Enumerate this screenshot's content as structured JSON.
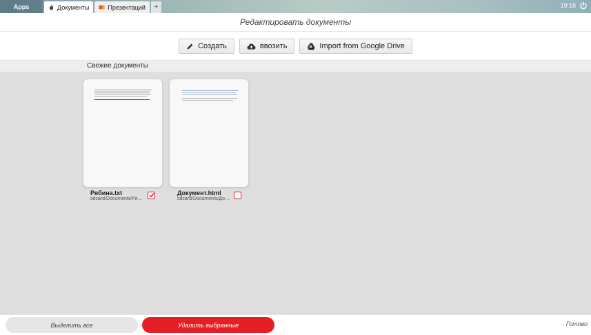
{
  "tabbar": {
    "apps_label": "Apps",
    "tabs": [
      {
        "label": "Документы",
        "icon": "flame-icon",
        "active": true
      },
      {
        "label": "Презентаций",
        "icon": "slides-icon",
        "active": false
      }
    ],
    "add_label": "+",
    "clock": "19:18",
    "power_icon": "power-icon"
  },
  "page": {
    "title": "Редактировать документы"
  },
  "toolbar": {
    "create_label": "Создать",
    "import_label": "ввозить",
    "gdrive_label": "Import from Google Drive"
  },
  "recent": {
    "header": "Свежие документы",
    "documents": [
      {
        "name": "Рябина.txt",
        "path": "sdcard/Documents/Рябина.txt",
        "checked": true
      },
      {
        "name": "Документ.html",
        "path": "sdcard/Documents/Документ.html",
        "checked": false
      }
    ]
  },
  "bottom": {
    "select_all_label": "Выделить все",
    "delete_selected_label": "Удалить выбранные",
    "status": "Готово"
  },
  "colors": {
    "accent_red": "#e31e24",
    "content_bg": "#dedede"
  }
}
